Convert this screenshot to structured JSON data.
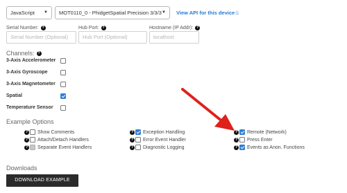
{
  "language_select": {
    "value": "JavaScript"
  },
  "device_select": {
    "value": "MOT0110_0 - PhidgetSpatial Precision 3/3/3"
  },
  "api_link": {
    "label": "View API for this device"
  },
  "fields": {
    "serial": {
      "label": "Serial Number:",
      "placeholder": "Serial Number (Optional)"
    },
    "hub": {
      "label": "Hub Port:",
      "placeholder": "Hub Port (Optional)"
    },
    "hostname": {
      "label": "Hostname (IP Addr):",
      "placeholder": "localhost"
    }
  },
  "channels": {
    "title": "Channels:",
    "items": [
      {
        "label": "3-Axis Accelerometer",
        "checked": false
      },
      {
        "label": "3-Axis Gyroscope",
        "checked": false
      },
      {
        "label": "3-Axis Magnetometer",
        "checked": false
      },
      {
        "label": "Spatial",
        "checked": true
      },
      {
        "label": "Temperature Sensor",
        "checked": false
      }
    ]
  },
  "example_options": {
    "title": "Example Options",
    "items": [
      {
        "label": "Show Comments",
        "checked": false,
        "disabled": false
      },
      {
        "label": "Attach/Detach Handlers",
        "checked": false,
        "disabled": false
      },
      {
        "label": "Separate Event Handlers",
        "checked": false,
        "disabled": true
      },
      {
        "label": "Exception Handling",
        "checked": true,
        "disabled": false
      },
      {
        "label": "Error Event Handler",
        "checked": false,
        "disabled": false
      },
      {
        "label": "Diagnostic Logging",
        "checked": false,
        "disabled": false
      },
      {
        "label": "Remote (Network)",
        "checked": true,
        "disabled": false
      },
      {
        "label": "Press Enter",
        "checked": false,
        "disabled": false
      },
      {
        "label": "Events as Anon. Functions",
        "checked": true,
        "disabled": false
      }
    ]
  },
  "downloads": {
    "title": "Downloads",
    "button_label": "DOWNLOAD EXAMPLE"
  },
  "colors": {
    "link": "#2a7bd1",
    "checkbox_on": "#2f7fd6",
    "arrow": "#e0201b",
    "button_bg": "#2b2b2b"
  }
}
